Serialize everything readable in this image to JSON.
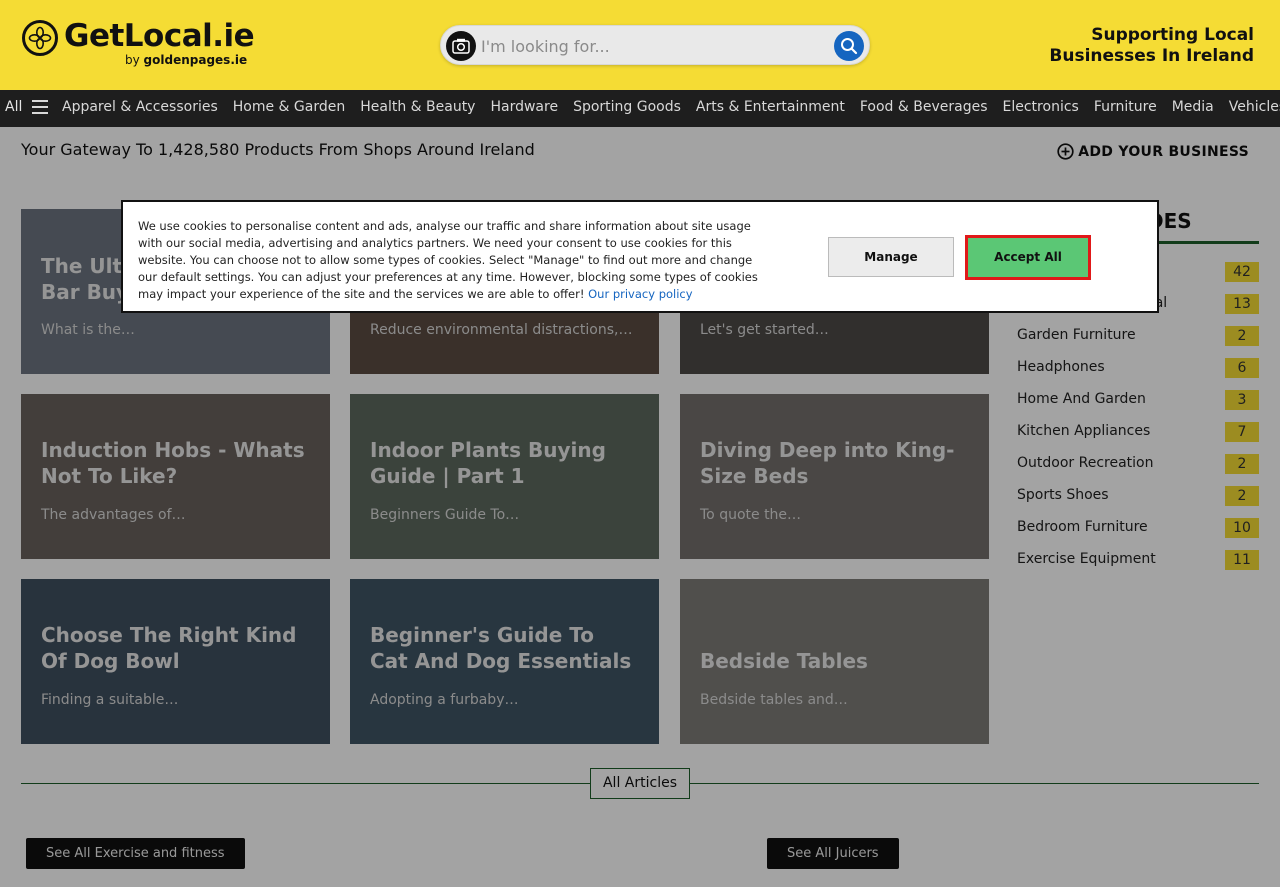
{
  "header": {
    "logo_text": "GetLocal.ie",
    "logo_sub_prefix": "by ",
    "logo_sub_brand": "goldenpages.ie",
    "search_placeholder": "I'm looking for...",
    "tagline_line1": "Supporting Local",
    "tagline_line2": "Businesses In Ireland"
  },
  "nav": {
    "all_label": "All",
    "items": [
      "Apparel & Accessories",
      "Home & Garden",
      "Health & Beauty",
      "Hardware",
      "Sporting Goods",
      "Arts & Entertainment",
      "Food & Beverages",
      "Electronics",
      "Furniture",
      "Media",
      "Vehicles"
    ]
  },
  "main": {
    "gateway_text": "Your Gateway To 1,428,580 Products From Shops Around Ireland",
    "add_business_label": "ADD YOUR BUSINESS"
  },
  "articles": [
    {
      "title": "The Ult… Bar Buy…",
      "title_line1": "The Ult",
      "title_line2": "Bar Buy",
      "desc": "What is the…"
    },
    {
      "title": "",
      "title_line1": "",
      "title_line2": "",
      "desc": "Reduce environmental distractions,…"
    },
    {
      "title": "",
      "title_line1": "",
      "title_line2": "",
      "desc": "Let's get started…"
    },
    {
      "title_line1": "Induction Hobs - Whats",
      "title_line2": "Not To Like?",
      "desc": "The advantages of…"
    },
    {
      "title_line1": "Indoor Plants Buying",
      "title_line2": "Guide | Part 1",
      "desc": "Beginners Guide To…"
    },
    {
      "title_line1": "Diving Deep into King-",
      "title_line2": "Size Beds",
      "desc": "To quote the…"
    },
    {
      "title_line1": "Choose The Right Kind",
      "title_line2": "Of Dog Bowl",
      "desc": "Finding a suitable…"
    },
    {
      "title_line1": "Beginner's Guide To",
      "title_line2": "Cat And Dog Essentials",
      "desc": "Adopting a furbaby…"
    },
    {
      "title_line1": "",
      "title_line2": "Bedside Tables",
      "desc": "Bedside tables and…"
    }
  ],
  "sidebar": {
    "heading": "DES",
    "categories": [
      {
        "name": "",
        "count": "42"
      },
      {
        "name": "cal",
        "count": "13"
      },
      {
        "name": "Garden Furniture",
        "count": "2"
      },
      {
        "name": "Headphones",
        "count": "6"
      },
      {
        "name": "Home And Garden",
        "count": "3"
      },
      {
        "name": "Kitchen Appliances",
        "count": "7"
      },
      {
        "name": "Outdoor Recreation",
        "count": "2"
      },
      {
        "name": "Sports Shoes",
        "count": "2"
      },
      {
        "name": "Bedroom Furniture",
        "count": "10"
      },
      {
        "name": "Exercise Equipment",
        "count": "11"
      }
    ]
  },
  "footer": {
    "all_articles_label": "All Articles",
    "see_all_left": "See All Exercise and fitness",
    "see_all_right": "See All Juicers"
  },
  "cookie": {
    "text": "We use cookies to personalise content and ads, analyse our traffic and share information about site usage with our social media, advertising and analytics partners. We need your consent to use cookies for this website. You can choose not to allow some types of cookies. Select \"Manage\" to find out more and change our default settings. You can adjust your preferences at any time. However, blocking some types of cookies may impact your experience of the site and the services we are able to offer!",
    "privacy_link": "Our privacy policy",
    "manage_label": "Manage",
    "accept_label": "Accept All"
  },
  "colors": {
    "header_bg": "#f5dc34",
    "nav_bg": "#1e1e1e",
    "accent_green": "#1d5e2a",
    "accept_green": "#5bc775",
    "highlight_red": "#e01919",
    "search_blue": "#1565c0"
  }
}
